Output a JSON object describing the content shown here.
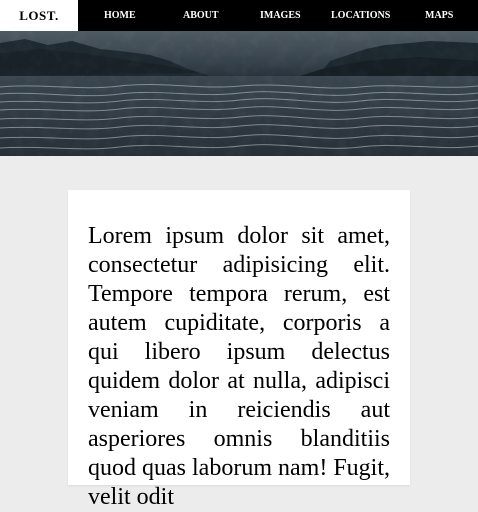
{
  "header": {
    "brand": "LOST.",
    "nav": [
      "HOME",
      "ABOUT",
      "IMAGES",
      "LOCATIONS",
      "MAPS"
    ]
  },
  "main": {
    "paragraph": "Lorem ipsum dolor sit amet, consectetur adipisicing elit. Tempore tempora rerum, est autem cupiditate, corporis a qui libero ipsum delectus quidem dolor at nulla, adipisci veniam in reiciendis aut asperiores omnis blanditiis quod quas laborum nam! Fugit, velit odit"
  },
  "colors": {
    "topbar_bg": "#000000",
    "brand_bg": "#ffffff",
    "page_bg": "#ececec",
    "card_bg": "#ffffff"
  }
}
